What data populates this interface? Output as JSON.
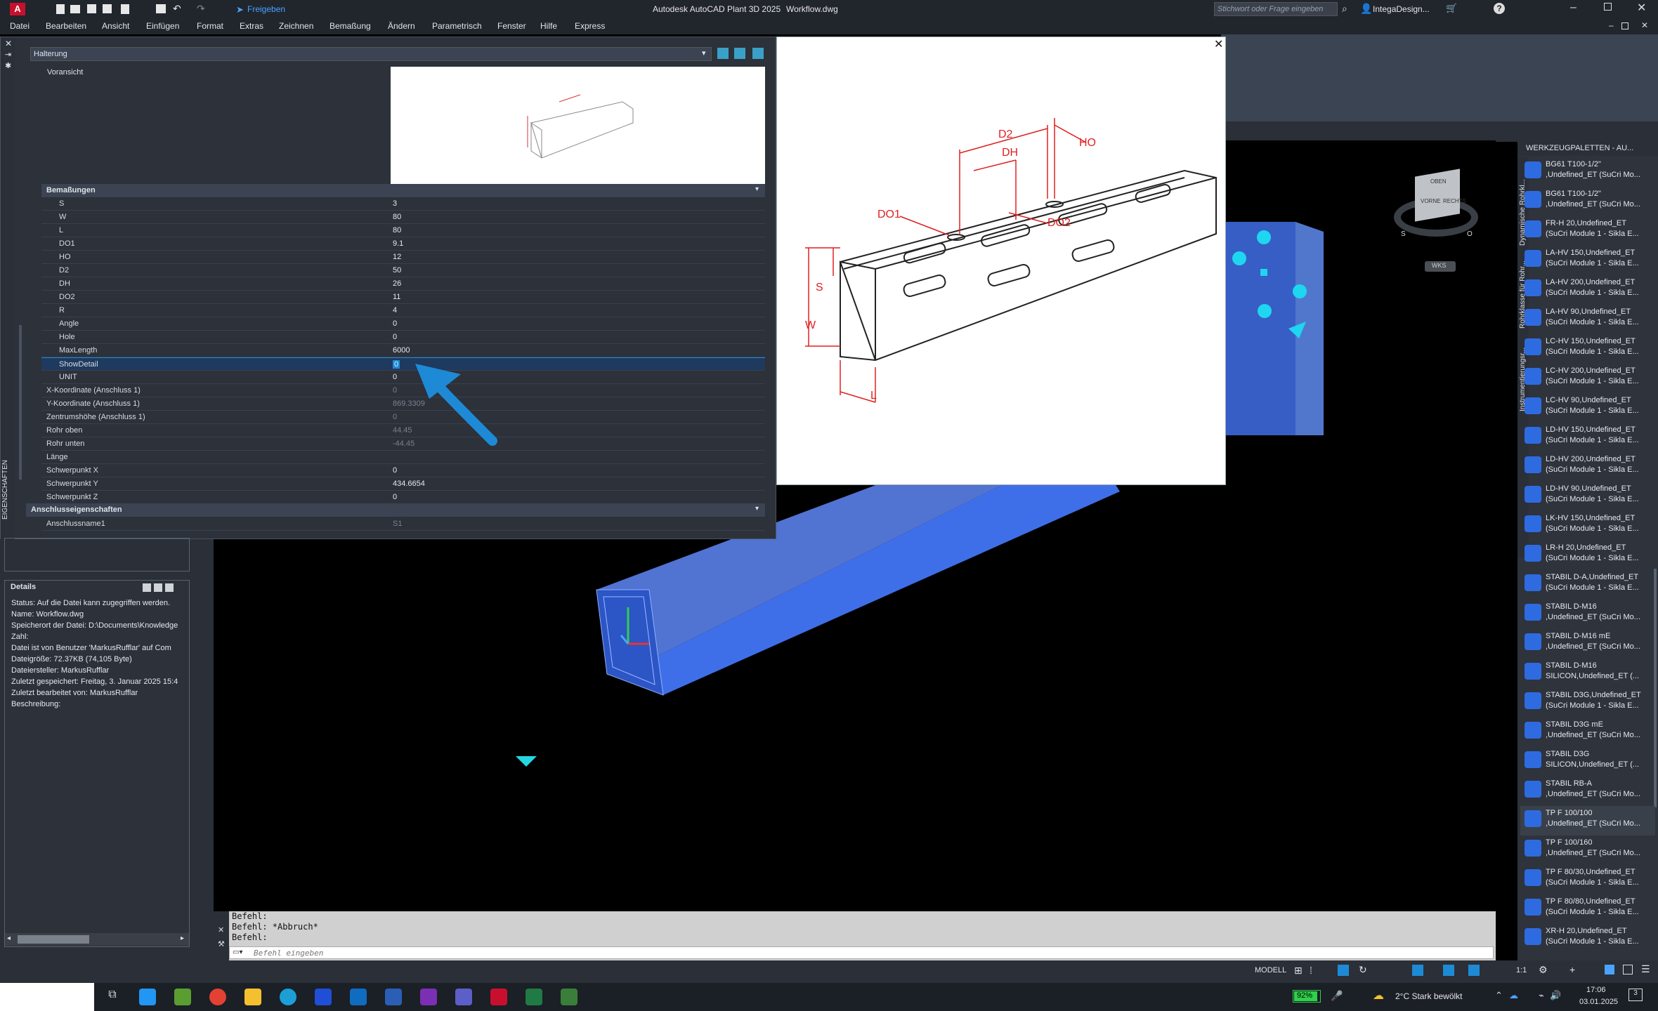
{
  "title": {
    "app": "Autodesk AutoCAD Plant 3D 2025",
    "file": "Workflow.dwg",
    "share": "Freigeben",
    "search_placeholder": "Stichwort oder Frage eingeben",
    "user": "IntegaDesign..."
  },
  "menu": [
    "Datei",
    "Bearbeiten",
    "Ansicht",
    "Einfügen",
    "Format",
    "Extras",
    "Zeichnen",
    "Bemaßung",
    "Ändern",
    "Parametrisch",
    "Fenster",
    "Hilfe",
    "Express"
  ],
  "properties": {
    "selector": "Halterung",
    "preview_label": "Voransicht",
    "section_dims": "Bemaßungen",
    "rows": [
      {
        "name": "S",
        "value": "3"
      },
      {
        "name": "W",
        "value": "80"
      },
      {
        "name": "L",
        "value": "80"
      },
      {
        "name": "DO1",
        "value": "9.1"
      },
      {
        "name": "HO",
        "value": "12"
      },
      {
        "name": "D2",
        "value": "50"
      },
      {
        "name": "DH",
        "value": "26"
      },
      {
        "name": "DO2",
        "value": "11"
      },
      {
        "name": "R",
        "value": "4"
      },
      {
        "name": "Angle",
        "value": "0"
      },
      {
        "name": "Hole",
        "value": "0"
      },
      {
        "name": "MaxLength",
        "value": "6000"
      },
      {
        "name": "ShowDetail",
        "value": "0"
      },
      {
        "name": "UNIT",
        "value": "0"
      }
    ],
    "rows2": [
      {
        "name": "X-Koordinate (Anschluss 1)",
        "value": "0"
      },
      {
        "name": "Y-Koordinate (Anschluss 1)",
        "value": "869.3309"
      },
      {
        "name": "Zentrumshöhe (Anschluss 1)",
        "value": "0"
      },
      {
        "name": "Rohr oben",
        "value": "44.45"
      },
      {
        "name": "Rohr unten",
        "value": "-44.45"
      },
      {
        "name": "Länge",
        "value": ""
      },
      {
        "name": "Schwerpunkt X",
        "value": "0"
      },
      {
        "name": "Schwerpunkt Y",
        "value": "434.6654"
      },
      {
        "name": "Schwerpunkt Z",
        "value": "0"
      }
    ],
    "section_conn": "Anschlusseigenschaften",
    "conn_name": "Anschlussname1",
    "conn_value": "S1",
    "side_label": "EIGENSCHAFTEN"
  },
  "drawing_labels": [
    "D2",
    "HO",
    "DH",
    "DO1",
    "DO2",
    "S",
    "W",
    "L"
  ],
  "details": {
    "title": "Details",
    "lines": [
      "Status: Auf die Datei kann zugegriffen werden.",
      "Name: Workflow.dwg",
      "Speicherort der Datei: D:\\Documents\\Knowledge",
      "Zahl:",
      "Datei ist von Benutzer 'MarkusRufflar' auf Com",
      "Dateigröße: 72.37KB (74,105 Byte)",
      "Dateiersteller: MarkusRufflar",
      "Zuletzt gespeichert: Freitag, 3. Januar 2025 15:4",
      "Zuletzt bearbeitet von: MarkusRufflar",
      "Beschreibung:"
    ]
  },
  "viewcube": {
    "top": "OBEN",
    "front": "VORNE",
    "right": "RECHTS",
    "south": "S",
    "west": "O",
    "wcs": "WKS"
  },
  "palette": {
    "title": "WERKZEUGPALETTEN - AU...",
    "tabs": [
      "Dynamische Rohrkl...",
      "Rohrklasse für Rohr...",
      "Instrumentierungsr..."
    ],
    "items": [
      {
        "l1": "BG61 T100-1/2\"",
        "l2": ",Undefined_ET (SuCri Mo..."
      },
      {
        "l1": "BG61 T100-1/2\"",
        "l2": ",Undefined_ET (SuCri Mo..."
      },
      {
        "l1": "FR-H 20,Undefined_ET",
        "l2": "(SuCri Module 1 - Sikla E..."
      },
      {
        "l1": "LA-HV 150,Undefined_ET",
        "l2": "(SuCri Module 1 - Sikla E..."
      },
      {
        "l1": "LA-HV 200,Undefined_ET",
        "l2": "(SuCri Module 1 - Sikla E..."
      },
      {
        "l1": "LA-HV 90,Undefined_ET",
        "l2": "(SuCri Module 1 - Sikla E..."
      },
      {
        "l1": "LC-HV 150,Undefined_ET",
        "l2": "(SuCri Module 1 - Sikla E..."
      },
      {
        "l1": "LC-HV 200,Undefined_ET",
        "l2": "(SuCri Module 1 - Sikla E..."
      },
      {
        "l1": "LC-HV 90,Undefined_ET",
        "l2": "(SuCri Module 1 - Sikla E..."
      },
      {
        "l1": "LD-HV 150,Undefined_ET",
        "l2": "(SuCri Module 1 - Sikla E..."
      },
      {
        "l1": "LD-HV 200,Undefined_ET",
        "l2": "(SuCri Module 1 - Sikla E..."
      },
      {
        "l1": "LD-HV 90,Undefined_ET",
        "l2": "(SuCri Module 1 - Sikla E..."
      },
      {
        "l1": "LK-HV 150,Undefined_ET",
        "l2": "(SuCri Module 1 - Sikla E..."
      },
      {
        "l1": "LR-H 20,Undefined_ET",
        "l2": "(SuCri Module 1 - Sikla E..."
      },
      {
        "l1": "STABIL D-A,Undefined_ET",
        "l2": "(SuCri Module 1 - Sikla E..."
      },
      {
        "l1": "STABIL D-M16",
        "l2": ",Undefined_ET (SuCri Mo..."
      },
      {
        "l1": "STABIL D-M16 mE",
        "l2": ",Undefined_ET (SuCri Mo..."
      },
      {
        "l1": "STABIL D-M16",
        "l2": "SILICON,Undefined_ET (..."
      },
      {
        "l1": "STABIL D3G,Undefined_ET",
        "l2": "(SuCri Module 1 - Sikla E..."
      },
      {
        "l1": "STABIL D3G mE",
        "l2": ",Undefined_ET (SuCri Mo..."
      },
      {
        "l1": "STABIL D3G",
        "l2": "SILICON,Undefined_ET (..."
      },
      {
        "l1": "STABIL RB-A",
        "l2": ",Undefined_ET (SuCri Mo..."
      },
      {
        "l1": "TP F 100/100",
        "l2": ",Undefined_ET (SuCri Mo..."
      },
      {
        "l1": "TP F 100/160",
        "l2": ",Undefined_ET (SuCri Mo..."
      },
      {
        "l1": "TP F 80/30,Undefined_ET",
        "l2": "(SuCri Module 1 - Sikla E..."
      },
      {
        "l1": "TP F 80/80,Undefined_ET",
        "l2": "(SuCri Module 1 - Sikla E..."
      },
      {
        "l1": "XR-H 20,Undefined_ET",
        "l2": "(SuCri Module 1 - Sikla E..."
      }
    ]
  },
  "command": {
    "lines": [
      "Befehl:",
      "Befehl: *Abbruch*",
      "Befehl:"
    ],
    "placeholder": "Befehl eingeben"
  },
  "status": {
    "model": "MODELL",
    "scale": "1:1"
  },
  "taskbar": {
    "battery": "92%",
    "weather": "2°C  Stark bewölkt",
    "time": "17:06",
    "date": "03.01.2025",
    "notif": "3"
  },
  "colors": {
    "accent": "#1e8ad6",
    "dim_red": "#e02020",
    "solid_blue": "#3f6fe8"
  }
}
